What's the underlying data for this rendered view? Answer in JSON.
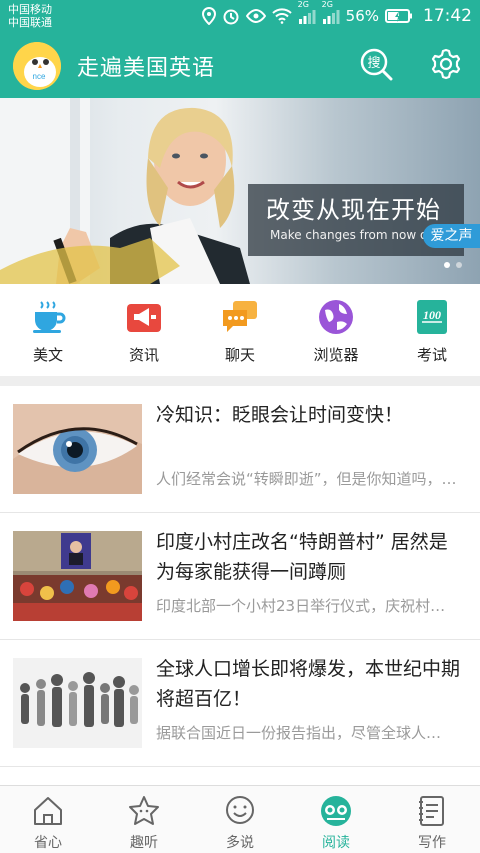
{
  "status_bar": {
    "carrier_1": "中国移动",
    "carrier_2": "中国联通",
    "network_1": "2G",
    "network_2": "2G",
    "battery": "56%",
    "time": "17:42"
  },
  "header": {
    "title": "走遍美国英语",
    "logo_text": "nce",
    "search_label": "搜"
  },
  "banner": {
    "headline": "改变从现在开始",
    "subline": "Make changes from now on",
    "brand_tag": "爱之声",
    "slide_count": 2,
    "active_slide": 1
  },
  "categories": [
    {
      "label": "美文",
      "icon": "teacup-icon",
      "color": "#2fa6e0"
    },
    {
      "label": "资讯",
      "icon": "megaphone-icon",
      "color": "#e8483e"
    },
    {
      "label": "聊天",
      "icon": "chat-bubbles-icon",
      "color": "#f29a1f"
    },
    {
      "label": "浏览器",
      "icon": "globe-icon",
      "color": "#9a55d8"
    },
    {
      "label": "考试",
      "icon": "exam-100-icon",
      "color": "#26b39b"
    }
  ],
  "news": [
    {
      "title": "冷知识：眨眼会让时间变快！",
      "summary": "人们经常会说“转瞬即逝”，但是你知道吗，…",
      "thumb": "eye-photo"
    },
    {
      "title": "印度小村庄改名“特朗普村” 居然是为每家能获得一间蹲厕",
      "summary": "印度北部一个小村23日举行仪式，庆祝村…",
      "thumb": "village-photo"
    },
    {
      "title": "全球人口增长即将爆发，本世纪中期将超百亿！",
      "summary": "据联合国近日一份报告指出，尽管全球人…",
      "thumb": "population-photo"
    }
  ],
  "bottom_nav": [
    {
      "label": "省心",
      "icon": "home-icon",
      "active": false
    },
    {
      "label": "趣听",
      "icon": "star-face-icon",
      "active": false
    },
    {
      "label": "多说",
      "icon": "smile-bubble-icon",
      "active": false
    },
    {
      "label": "阅读",
      "icon": "reading-glasses-icon",
      "active": true
    },
    {
      "label": "写作",
      "icon": "notebook-icon",
      "active": false
    }
  ],
  "colors": {
    "primary": "#26b39b",
    "summary_gray": "#9a9a9a"
  }
}
